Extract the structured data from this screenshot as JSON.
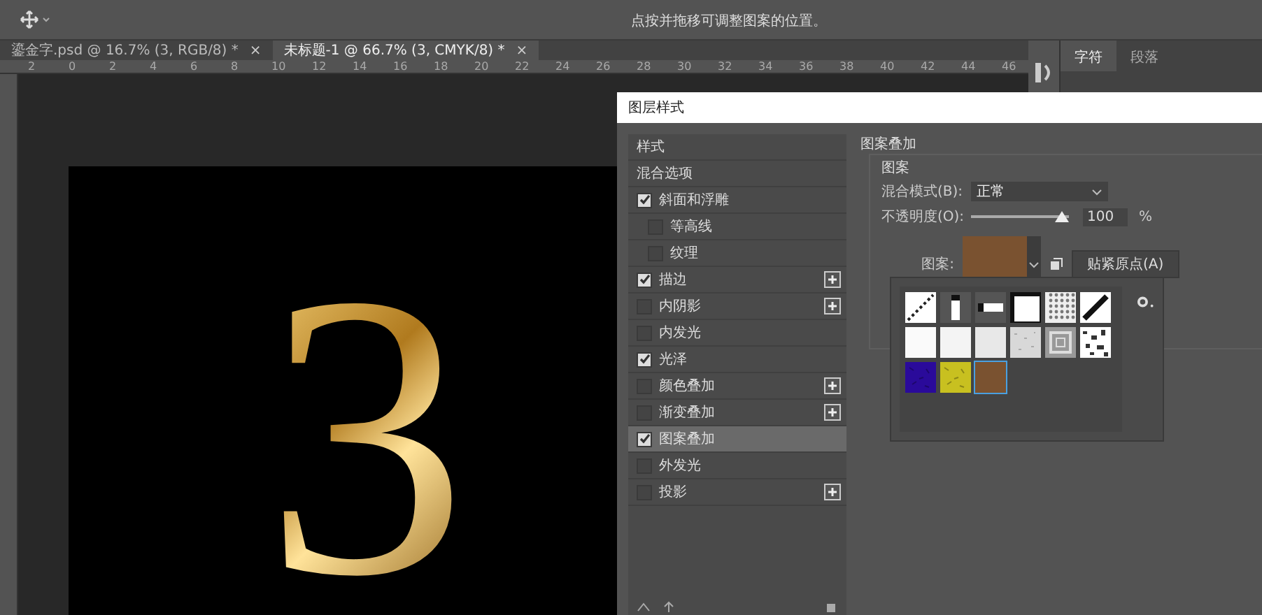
{
  "options_bar": {
    "hint": "点按并拖移可调整图案的位置。"
  },
  "doc_tabs": [
    {
      "label": "鎏金字.psd @ 16.7% (3, RGB/8) *",
      "close": "×",
      "selected": false
    },
    {
      "label": "未标题-1 @ 66.7% (3, CMYK/8) *",
      "close": "×",
      "selected": true
    }
  ],
  "ruler": [
    "2",
    "0",
    "2",
    "4",
    "6",
    "8",
    "10",
    "12",
    "14",
    "16",
    "18",
    "20",
    "22",
    "24",
    "26",
    "28",
    "30",
    "32",
    "34",
    "36",
    "38",
    "40",
    "42",
    "44",
    "46"
  ],
  "canvas": {
    "text": "3"
  },
  "panel_tabs": [
    {
      "label": "字符",
      "selected": true
    },
    {
      "label": "段落",
      "selected": false
    }
  ],
  "dialog": {
    "title": "图层样式",
    "styles": [
      {
        "kind": "heading",
        "label": "样式",
        "selected": false
      },
      {
        "kind": "heading",
        "label": "混合选项",
        "selected": false
      },
      {
        "kind": "check",
        "label": "斜面和浮雕",
        "checked": true,
        "selected": false,
        "add": false
      },
      {
        "kind": "sub",
        "label": "等高线",
        "checked": false,
        "selected": false,
        "add": false
      },
      {
        "kind": "sub",
        "label": "纹理",
        "checked": false,
        "selected": false,
        "add": false
      },
      {
        "kind": "check",
        "label": "描边",
        "checked": true,
        "selected": false,
        "add": true
      },
      {
        "kind": "check",
        "label": "内阴影",
        "checked": false,
        "selected": false,
        "add": true
      },
      {
        "kind": "check",
        "label": "内发光",
        "checked": false,
        "selected": false,
        "add": false
      },
      {
        "kind": "check",
        "label": "光泽",
        "checked": true,
        "selected": false,
        "add": false
      },
      {
        "kind": "check",
        "label": "颜色叠加",
        "checked": false,
        "selected": false,
        "add": true
      },
      {
        "kind": "check",
        "label": "渐变叠加",
        "checked": false,
        "selected": false,
        "add": true
      },
      {
        "kind": "check",
        "label": "图案叠加",
        "checked": true,
        "selected": true,
        "add": false
      },
      {
        "kind": "check",
        "label": "外发光",
        "checked": false,
        "selected": false,
        "add": false
      },
      {
        "kind": "check",
        "label": "投影",
        "checked": false,
        "selected": false,
        "add": true
      }
    ],
    "section_title": "图案叠加",
    "group_title": "图案",
    "blend_label": "混合模式(B):",
    "blend_value": "正常",
    "opacity_label": "不透明度(O):",
    "opacity": {
      "level": 1.0,
      "value": "100",
      "unit": "%"
    },
    "pattern_label": "图案:",
    "snap_button": "贴紧原点(A)",
    "swatches": [
      {
        "kind": "diagonal",
        "selected": false
      },
      {
        "kind": "vbar",
        "selected": false
      },
      {
        "kind": "hbar",
        "selected": false
      },
      {
        "kind": "frame",
        "selected": false
      },
      {
        "kind": "dots",
        "selected": false
      },
      {
        "kind": "diagonal-bold",
        "selected": false
      },
      {
        "kind": "plain",
        "color": "#fafafa",
        "selected": false
      },
      {
        "kind": "plain",
        "color": "#f4f4f4",
        "selected": false
      },
      {
        "kind": "plain",
        "color": "#e8e8e8",
        "selected": false
      },
      {
        "kind": "noise",
        "color": "#d8d8d8",
        "selected": false
      },
      {
        "kind": "concentric",
        "selected": false
      },
      {
        "kind": "speckle",
        "selected": false
      },
      {
        "kind": "texture",
        "color": "#2a0a9a",
        "selected": false
      },
      {
        "kind": "texture",
        "color": "#c8c020",
        "selected": false
      },
      {
        "kind": "plain",
        "color": "#7a5230",
        "selected": true
      }
    ]
  }
}
